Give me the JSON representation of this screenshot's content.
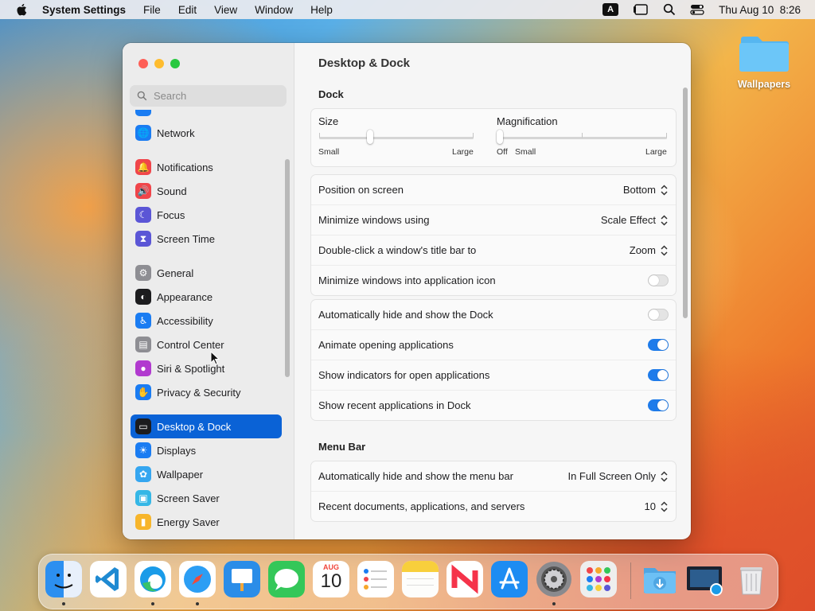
{
  "menubar": {
    "app": "System Settings",
    "items": [
      "File",
      "Edit",
      "View",
      "Window",
      "Help"
    ],
    "input_indicator": "A",
    "clock": "Thu Aug 10  8:26"
  },
  "desktop": {
    "folder_label": "Wallpapers"
  },
  "window": {
    "search_placeholder": "Search",
    "sidebar": [
      {
        "label": "Network",
        "icon": "globe-icon",
        "color": "#1a7cf2"
      },
      {
        "label": "Notifications",
        "icon": "bell-icon",
        "color": "#f0454a"
      },
      {
        "label": "Sound",
        "icon": "speaker-icon",
        "color": "#f0454a"
      },
      {
        "label": "Focus",
        "icon": "moon-icon",
        "color": "#5b56d6"
      },
      {
        "label": "Screen Time",
        "icon": "hourglass-icon",
        "color": "#5b56d6"
      },
      {
        "label": "General",
        "icon": "gear-icon",
        "color": "#8e8e93"
      },
      {
        "label": "Appearance",
        "icon": "appearance-icon",
        "color": "#1c1c1e"
      },
      {
        "label": "Accessibility",
        "icon": "accessibility-icon",
        "color": "#1a7cf2"
      },
      {
        "label": "Control Center",
        "icon": "control-center-icon",
        "color": "#8e8e93"
      },
      {
        "label": "Siri & Spotlight",
        "icon": "siri-icon",
        "color": "#b13acf"
      },
      {
        "label": "Privacy & Security",
        "icon": "hand-icon",
        "color": "#1a7cf2"
      },
      {
        "label": "Desktop & Dock",
        "icon": "dock-icon",
        "color": "#1c1c1e"
      },
      {
        "label": "Displays",
        "icon": "sun-icon",
        "color": "#1a7cf2"
      },
      {
        "label": "Wallpaper",
        "icon": "flower-icon",
        "color": "#35a6f0"
      },
      {
        "label": "Screen Saver",
        "icon": "screensaver-icon",
        "color": "#35b7e6"
      },
      {
        "label": "Energy Saver",
        "icon": "battery-icon",
        "color": "#f7b52b"
      }
    ],
    "selected": "Desktop & Dock",
    "title": "Desktop & Dock",
    "dock_section": "Dock",
    "size": {
      "label": "Size",
      "min": "Small",
      "max": "Large",
      "value": 0.33
    },
    "magnification": {
      "label": "Magnification",
      "off": "Off",
      "min": "Small",
      "max": "Large",
      "value": 0.0
    },
    "popups": [
      {
        "label": "Position on screen",
        "value": "Bottom"
      },
      {
        "label": "Minimize windows using",
        "value": "Scale Effect"
      },
      {
        "label": "Double-click a window's title bar to",
        "value": "Zoom"
      }
    ],
    "minimize_into_icon": {
      "label": "Minimize windows into application icon",
      "on": false
    },
    "toggles": [
      {
        "label": "Automatically hide and show the Dock",
        "on": false
      },
      {
        "label": "Animate opening applications",
        "on": true
      },
      {
        "label": "Show indicators for open applications",
        "on": true
      },
      {
        "label": "Show recent applications in Dock",
        "on": true
      }
    ],
    "menubar_section": "Menu Bar",
    "menubar_rows": [
      {
        "label": "Automatically hide and show the menu bar",
        "value": "In Full Screen Only"
      },
      {
        "label": "Recent documents, applications, and servers",
        "value": "10"
      }
    ]
  },
  "dock": {
    "apps": [
      "Finder",
      "Visual Studio Code",
      "Microsoft Edge",
      "Safari",
      "Keynote",
      "Messages",
      "Calendar",
      "Reminders",
      "Notes",
      "News",
      "App Store",
      "System Settings",
      "Launchpad",
      "Downloads",
      "Screenshot",
      "Trash"
    ],
    "calendar_month": "AUG",
    "calendar_day": "10"
  }
}
